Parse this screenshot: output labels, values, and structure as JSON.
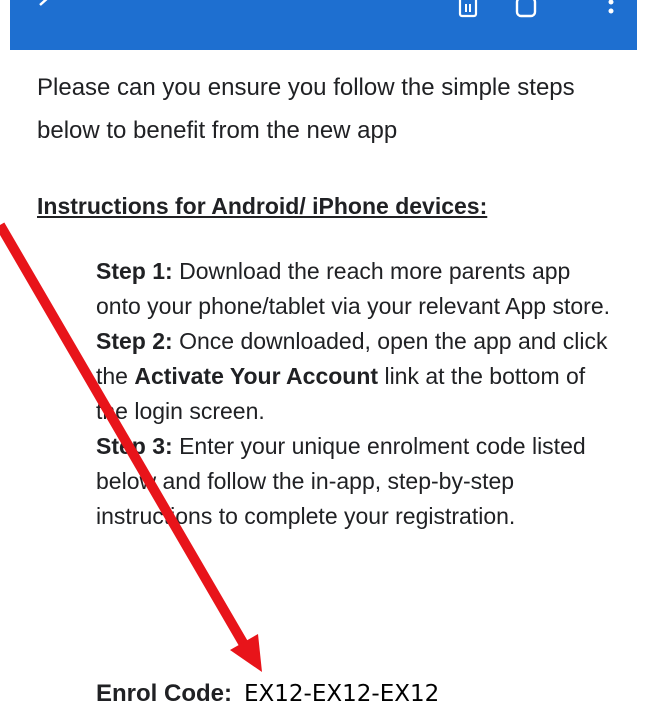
{
  "app_bar": {
    "icons": [
      "back-icon",
      "delete-icon",
      "box-icon",
      "more-icon"
    ],
    "color": "#1e6fd0"
  },
  "intro_text": "Please can you ensure you follow the simple steps below to benefit from the new app",
  "instructions_heading": "Instructions for Android/ iPhone devices:",
  "steps": [
    {
      "label": "Step 1:",
      "text": " Download the reach more parents app onto your phone/tablet via your relevant App store."
    },
    {
      "label": "Step 2:",
      "text_before": " Once downloaded, open the app and click the ",
      "bold": "Activate Your Account",
      "text_after": " link at the bottom of the login screen."
    },
    {
      "label": "Step 3:",
      "text": " Enter your unique enrolment code listed below and follow the in-app, step-by-step instructions to complete your registration."
    }
  ],
  "enrol": {
    "label": "Enrol Code:",
    "code": "EX12-EX12-EX12"
  },
  "annotation": {
    "arrow_color": "#e8141a"
  }
}
